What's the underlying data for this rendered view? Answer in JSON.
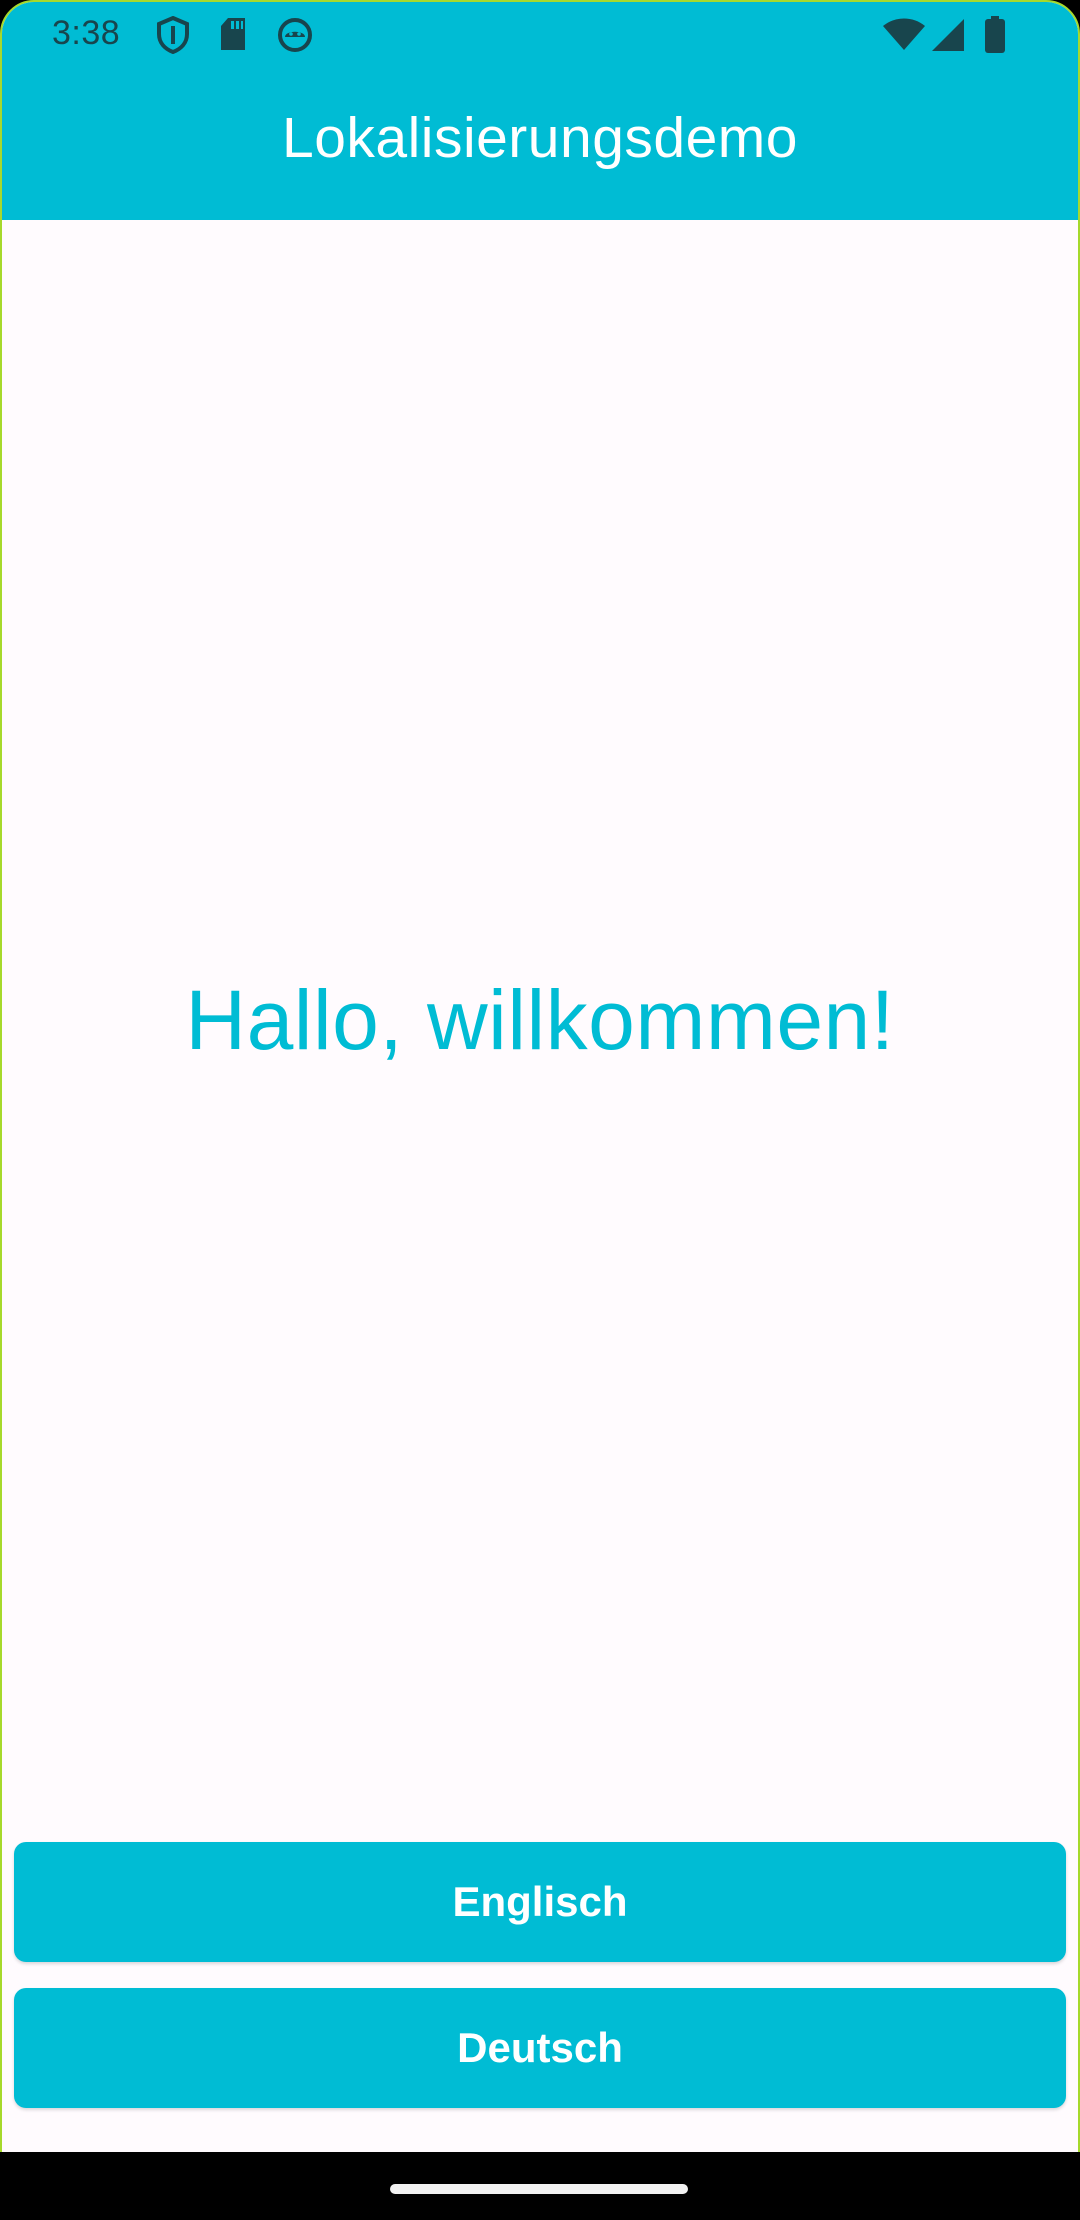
{
  "status_bar": {
    "time": "3:38",
    "left_icons": [
      "vpn-shield-icon",
      "sd-card-icon",
      "android-debug-icon"
    ],
    "right_icons": [
      "wifi-icon",
      "cellular-signal-icon",
      "battery-icon"
    ]
  },
  "app_bar": {
    "title": "Lokalisierungsdemo"
  },
  "main": {
    "greeting": "Hallo, willkommen!"
  },
  "buttons": {
    "english_label": "Englisch",
    "german_label": "Deutsch"
  },
  "colors": {
    "primary": "#00BCD4",
    "background": "#FFFBFE",
    "on_primary": "#FFFFFF",
    "status_icons": "#18454D"
  }
}
